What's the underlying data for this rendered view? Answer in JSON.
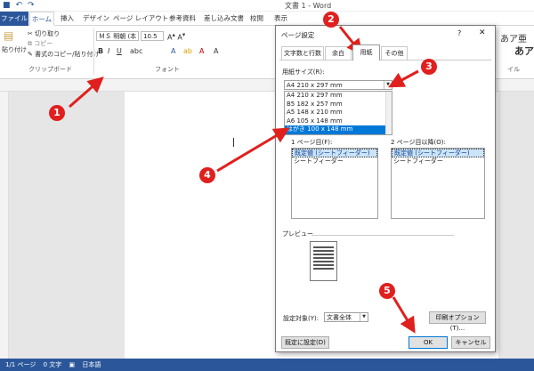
{
  "window": {
    "doc_title": "文書 1 - Word"
  },
  "ribbon_tabs": [
    {
      "label": "ファイル"
    },
    {
      "label": "ホーム"
    },
    {
      "label": "挿入"
    },
    {
      "label": "デザイン"
    },
    {
      "label": "ページ レイアウト"
    },
    {
      "label": "参考資料"
    },
    {
      "label": "差し込み文書"
    },
    {
      "label": "校閲"
    },
    {
      "label": "表示"
    }
  ],
  "ribbon": {
    "paste_label": "貼り付け",
    "cut_label": "切り取り",
    "copy_label": "コピー",
    "format_painter_label": "書式のコピー/貼り付け",
    "clipboard_group": "クリップボード",
    "font_name": "ＭＳ 明朝 (本",
    "font_size": "10.5",
    "font_group": "フォント",
    "style_label_1": "あア亜",
    "style_label_2": "あア",
    "style_group_fragment": "イル"
  },
  "status": {
    "page": "1/1 ページ",
    "words": "0 文字",
    "lang": "日本語"
  },
  "dialog": {
    "title": "ページ設定",
    "help": "?",
    "close": "✕",
    "tabs": [
      "文字数と行数",
      "余白",
      "用紙",
      "その他"
    ],
    "active_tab": "用紙",
    "paper_size_label": "用紙サイズ(R):",
    "paper_size_value": "A4 210 x 297 mm",
    "paper_options": [
      "A4 210 x 297 mm",
      "B5 182 x 257 mm",
      "A5 148 x 210 mm",
      "A6 105 x 148 mm",
      "はがき 100 x 148 mm"
    ],
    "first_page_label": "1 ページ目(F):",
    "other_pages_label": "2 ページ目以降(O):",
    "tray_options": [
      "既定値 (シートフィーダー)",
      "シートフィーダー"
    ],
    "preview_label": "プレビュー",
    "apply_to_label": "設定対象(Y):",
    "apply_to_value": "文書全体",
    "print_options_button": "印刷オプション(T)...",
    "default_button": "既定に設定(D)",
    "ok_button": "OK",
    "cancel_button": "キャンセル"
  },
  "annotations": [
    "1",
    "2",
    "3",
    "4",
    "5"
  ],
  "colors": {
    "word_blue": "#2b579a",
    "selection_blue": "#0078d7",
    "annotation_red": "#e0201e"
  }
}
